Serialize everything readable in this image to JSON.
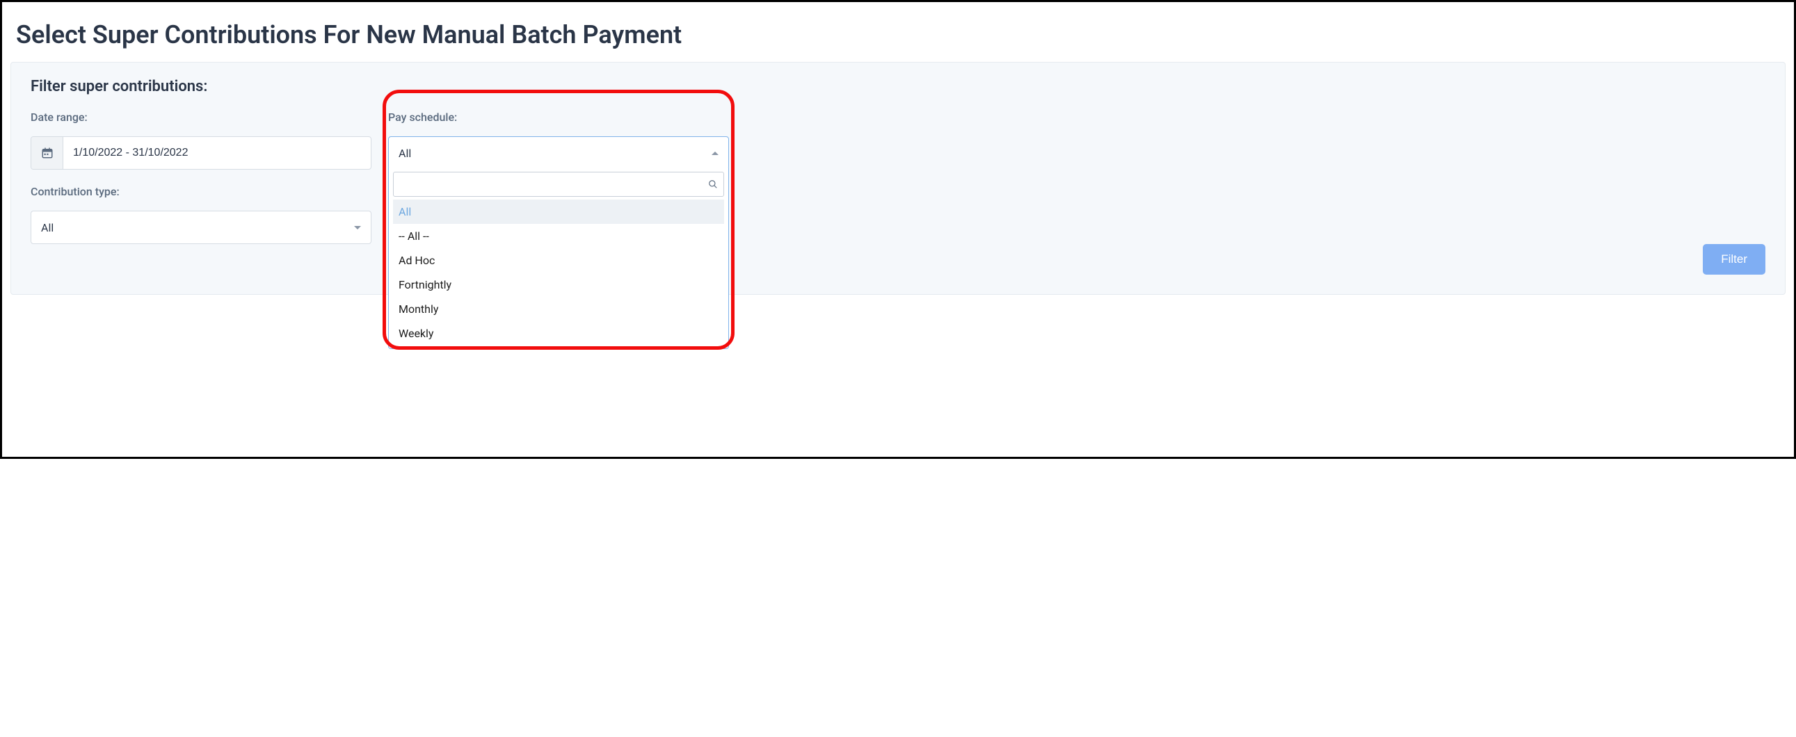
{
  "page_title": "Select Super Contributions For New Manual Batch Payment",
  "filter_heading": "Filter super contributions:",
  "date_range": {
    "label": "Date range:",
    "value": "1/10/2022 - 31/10/2022"
  },
  "contribution_type": {
    "label": "Contribution type:",
    "selected": "All"
  },
  "pay_schedule": {
    "label": "Pay schedule:",
    "selected": "All",
    "search_value": "",
    "options": [
      "All",
      "-- All --",
      "Ad Hoc",
      "Fortnightly",
      "Monthly",
      "Weekly"
    ]
  },
  "filter_button": "Filter"
}
